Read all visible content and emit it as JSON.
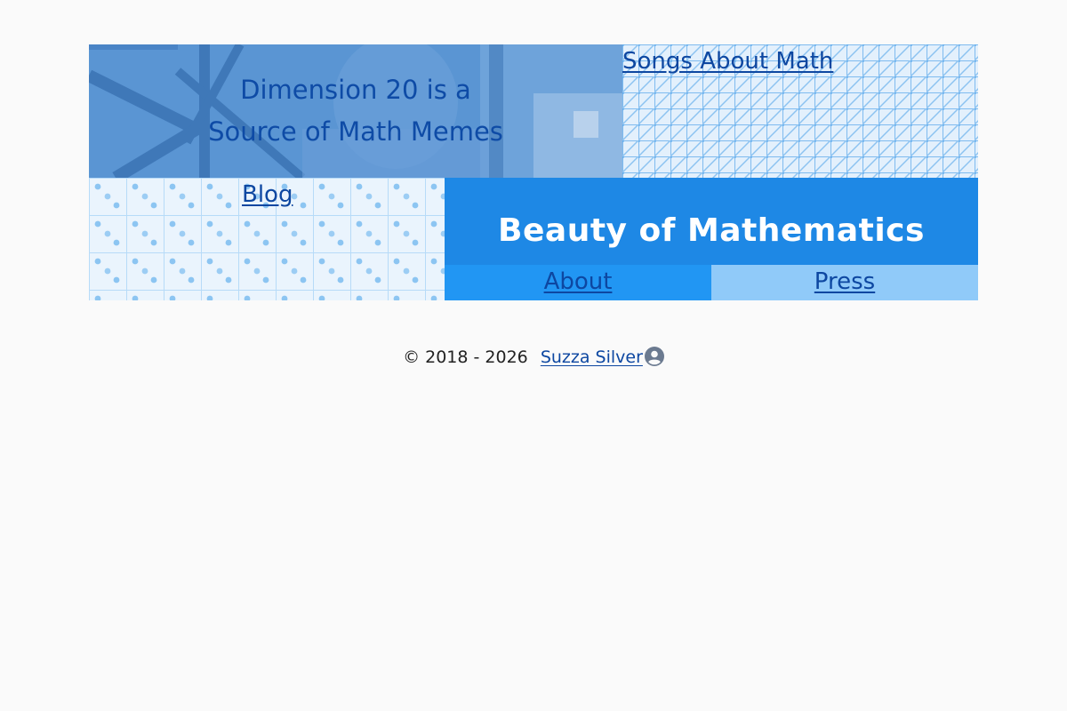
{
  "tiles": {
    "feature": {
      "line1": "Dimension 20 is a",
      "line2": "Source of Math Memes"
    },
    "songs": {
      "label": "Songs About Math"
    },
    "blog": {
      "label": "Blog"
    },
    "title": {
      "label": "Beauty of Mathematics"
    },
    "about": {
      "label": "About"
    },
    "press": {
      "label": "Press"
    }
  },
  "footer": {
    "copyright": "© 2018 - 2026",
    "author": "Suzza Silver",
    "author_icon": "user-circle-icon"
  },
  "colors": {
    "title_bg": "#1e88e5",
    "about_bg": "#2196f3",
    "press_bg": "#90caf9",
    "link": "#0d47a1",
    "page_bg": "#fafafa"
  }
}
